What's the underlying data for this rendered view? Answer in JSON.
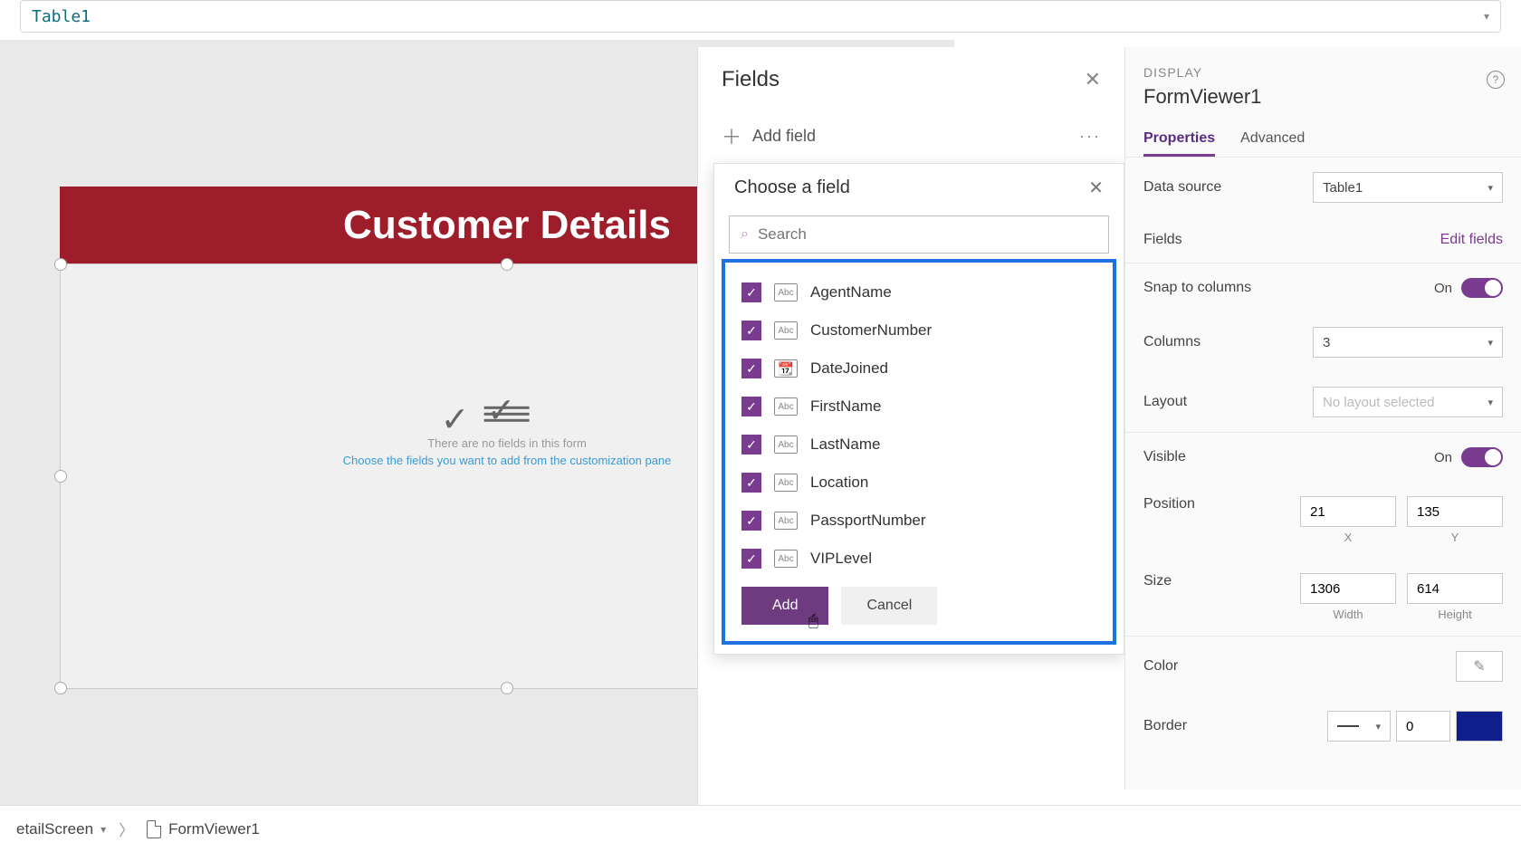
{
  "formula_bar": {
    "text": "Table1"
  },
  "canvas": {
    "title": "Customer Details",
    "form_placeholder_msg1": "There are no fields in this form",
    "form_placeholder_msg2": "Choose the fields you want to add from the customization pane"
  },
  "fields_pane": {
    "title": "Fields",
    "add_field": "Add field"
  },
  "choose_popup": {
    "title": "Choose a field",
    "search_placeholder": "Search",
    "add_label": "Add",
    "cancel_label": "Cancel",
    "items": [
      {
        "name": "AgentName",
        "icon": "Abc",
        "checked": true
      },
      {
        "name": "CustomerNumber",
        "icon": "Abc",
        "checked": true
      },
      {
        "name": "DateJoined",
        "icon": "date",
        "checked": true
      },
      {
        "name": "FirstName",
        "icon": "Abc",
        "checked": true
      },
      {
        "name": "LastName",
        "icon": "Abc",
        "checked": true
      },
      {
        "name": "Location",
        "icon": "Abc",
        "checked": true
      },
      {
        "name": "PassportNumber",
        "icon": "Abc",
        "checked": true
      },
      {
        "name": "VIPLevel",
        "icon": "Abc",
        "checked": true
      }
    ]
  },
  "properties": {
    "section": "DISPLAY",
    "object": "FormViewer1",
    "tabs": {
      "properties": "Properties",
      "advanced": "Advanced"
    },
    "data_source_label": "Data source",
    "data_source_value": "Table1",
    "fields_label": "Fields",
    "edit_fields": "Edit fields",
    "snap_label": "Snap to columns",
    "snap_value": "On",
    "columns_label": "Columns",
    "columns_value": "3",
    "layout_label": "Layout",
    "layout_value": "No layout selected",
    "visible_label": "Visible",
    "visible_value": "On",
    "position_label": "Position",
    "position_x": "21",
    "position_y": "135",
    "x_label": "X",
    "y_label": "Y",
    "size_label": "Size",
    "size_w": "1306",
    "size_h": "614",
    "w_label": "Width",
    "h_label": "Height",
    "color_label": "Color",
    "border_label": "Border",
    "border_value": "0"
  },
  "breadcrumb": {
    "crumb1": "etailScreen",
    "crumb2": "FormViewer1"
  }
}
